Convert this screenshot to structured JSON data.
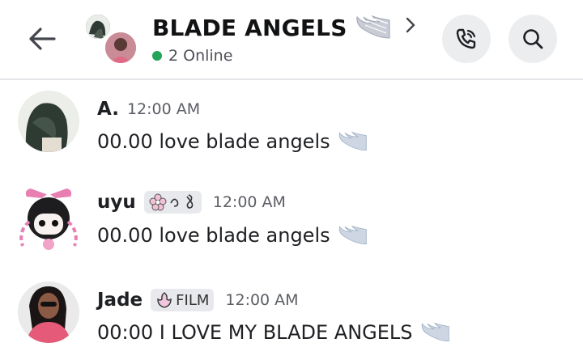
{
  "header": {
    "title": "BLADE ANGELS",
    "online_text": "2 Online",
    "icons": {
      "back": "arrow-left-icon",
      "call": "phone-call-icon",
      "search": "search-icon",
      "chevron": "chevron-right-icon",
      "title_emoji": "angel-wing-emoji"
    }
  },
  "messages": [
    {
      "name": "A.",
      "time": "12:00 AM",
      "text": "00.00 love blade angels",
      "emoji": "angel-wing-emoji"
    },
    {
      "name": "uyu",
      "time": "12:00 AM",
      "text": "00.00 love blade angels",
      "emoji": "angel-wing-emoji",
      "tag_icons": [
        "sakura-flower-icon",
        "music-note-icon"
      ]
    },
    {
      "name": "Jade",
      "time": "12:00 AM",
      "text": "00:00 I LOVE MY BLADE ANGELS",
      "emoji": "angel-wing-emoji",
      "tag_label": "FILM",
      "tag_icon": "flower-icon"
    }
  ],
  "colors": {
    "online": "#23a559",
    "divider": "#e3e5e8",
    "button_bg": "#ebedef"
  }
}
